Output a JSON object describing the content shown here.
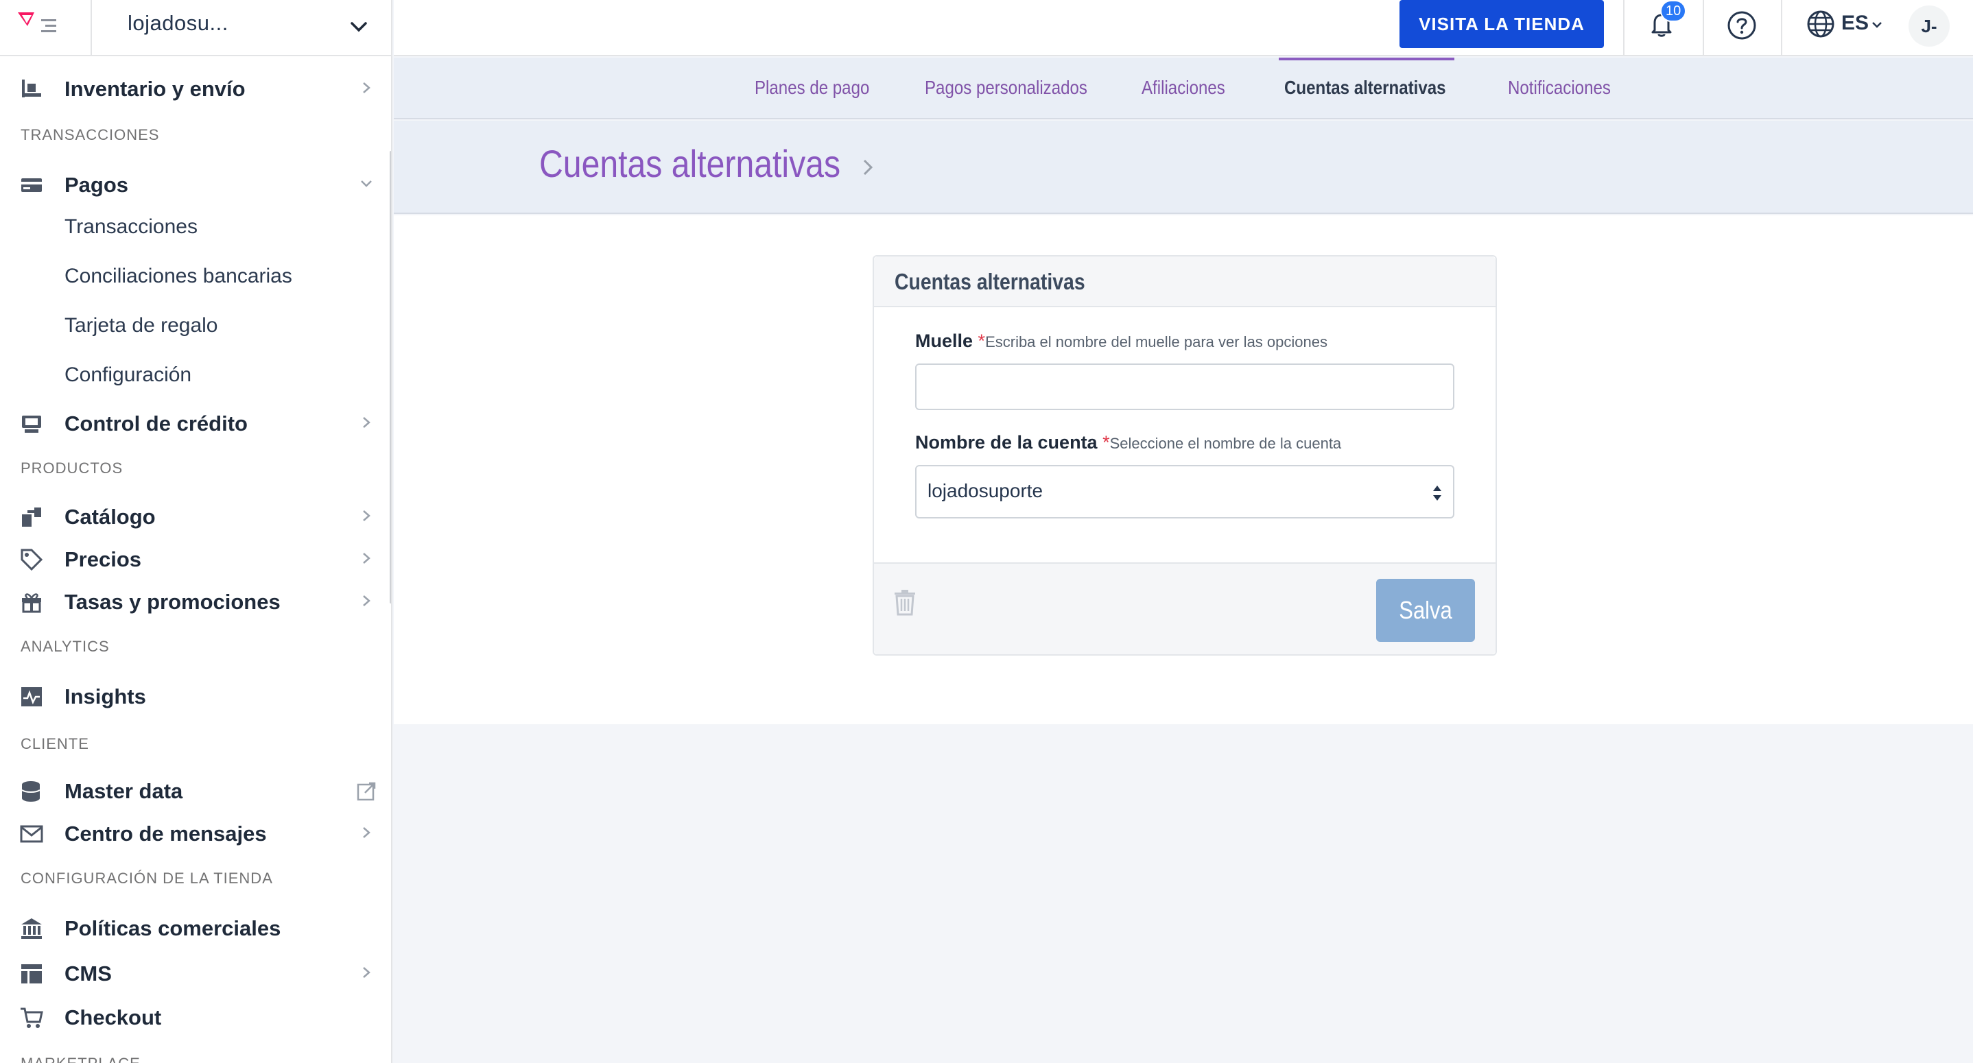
{
  "sidebar": {
    "store_name": "lojadosu...",
    "sections": {
      "transacciones": "TRANSACCIONES",
      "productos": "PRODUCTOS",
      "analytics": "ANALYTICS",
      "cliente": "CLIENTE",
      "configuracion": "CONFIGURACIÓN DE LA TIENDA",
      "marketplace": "MARKETPLACE"
    },
    "items": {
      "inventario": "Inventario y envío",
      "pagos": "Pagos",
      "control_credito": "Control de crédito",
      "catalogo": "Catálogo",
      "precios": "Precios",
      "tasas": "Tasas y promociones",
      "insights": "Insights",
      "master_data": "Master data",
      "centro_mensajes": "Centro de mensajes",
      "politicas": "Políticas comerciales",
      "cms": "CMS",
      "checkout": "Checkout"
    },
    "pagos_sub": {
      "transacciones": "Transacciones",
      "conciliaciones": "Conciliaciones bancarias",
      "tarjeta": "Tarjeta de regalo",
      "configuracion": "Configuración"
    }
  },
  "topbar": {
    "visit_label": "VISITA LA TIENDA",
    "notification_count": "10",
    "language": "ES",
    "user_initials": "J-"
  },
  "tabs": {
    "planes": "Planes de pago",
    "pagos_personalizados": "Pagos personalizados",
    "afiliaciones": "Afiliaciones",
    "cuentas": "Cuentas alternativas",
    "notificaciones": "Notificaciones"
  },
  "page": {
    "title": "Cuentas alternativas"
  },
  "form": {
    "card_title": "Cuentas alternativas",
    "muelle_label": "Muelle",
    "muelle_hint": "Escriba el nombre del muelle para ver las opciones",
    "muelle_value": "",
    "cuenta_label": "Nombre de la cuenta",
    "cuenta_hint": "Seleccione el nombre de la cuenta",
    "cuenta_value": "lojadosuporte",
    "required_mark": "*",
    "save_label": "Salva"
  },
  "colors": {
    "accent_purple": "#8a57c0",
    "primary_blue": "#134cd8",
    "save_disabled": "#89aed6"
  }
}
